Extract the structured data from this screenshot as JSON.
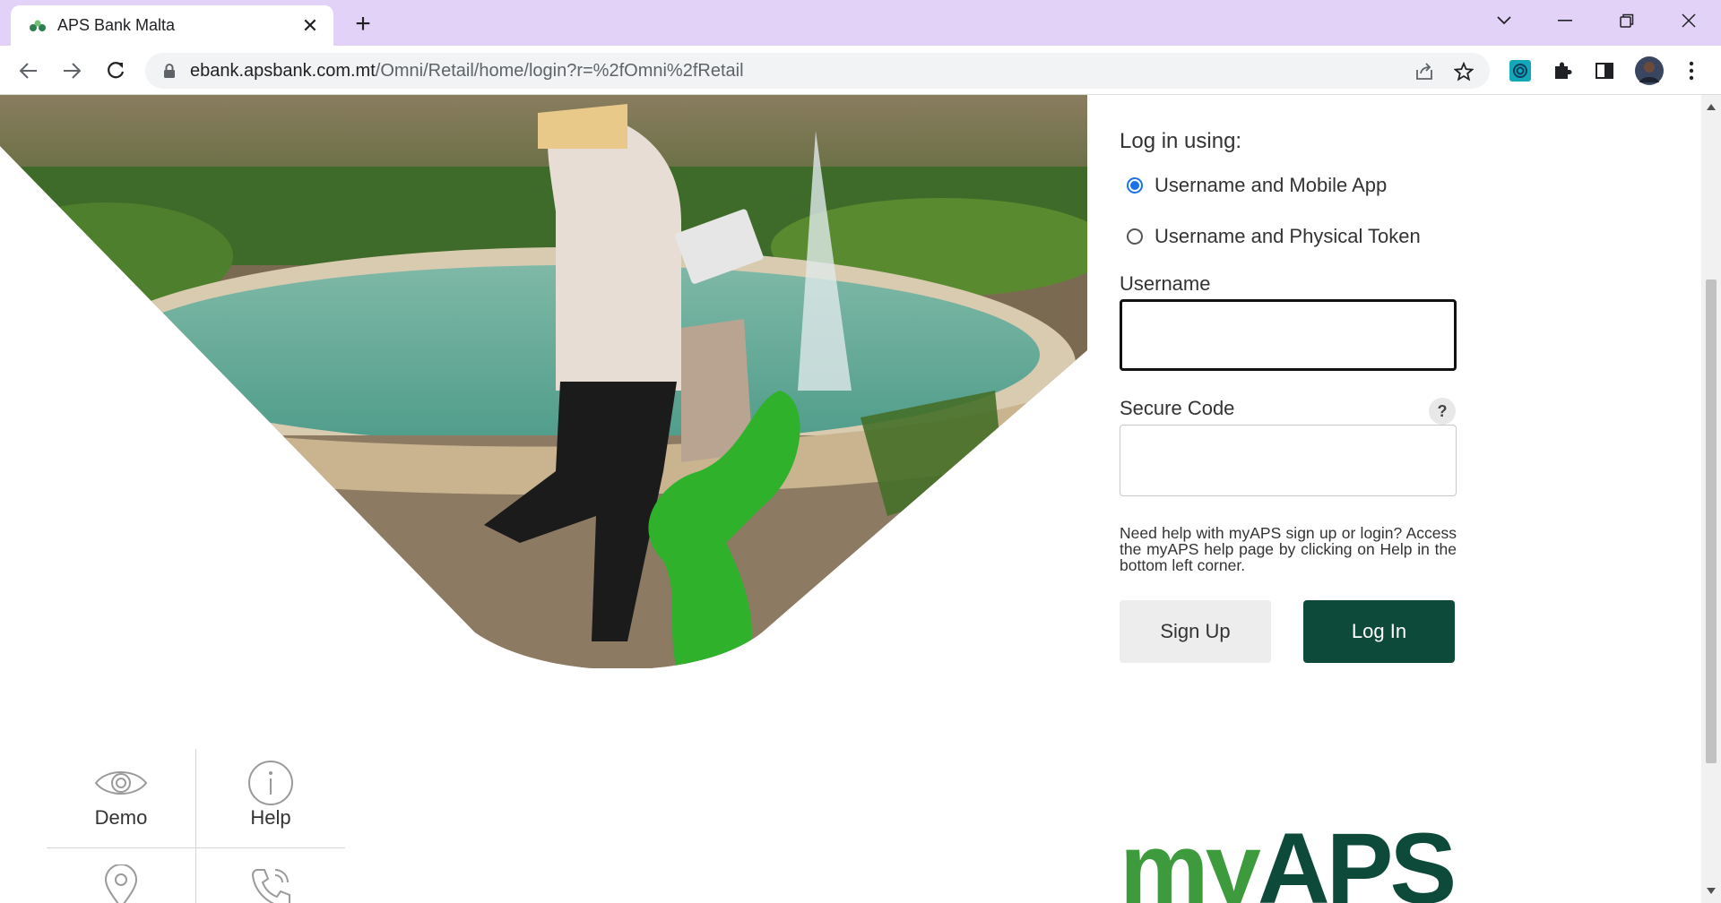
{
  "browser": {
    "tab_title": "APS Bank Malta",
    "url_host": "ebank.apsbank.com.mt",
    "url_path": "/Omni/Retail/home/login?r=%2fOmni%2fRetail",
    "icons": [
      "back-icon",
      "forward-icon",
      "reload-icon",
      "lock-icon",
      "share-icon",
      "bookmark-star-icon",
      "extension-icon",
      "puzzle-icon",
      "side-panel-icon",
      "profile-avatar",
      "menu-icon",
      "minimize-icon",
      "restore-icon",
      "close-icon",
      "tab-search-icon"
    ],
    "theme_color": "#e3d2f7"
  },
  "login": {
    "heading": "Log in using:",
    "options": [
      {
        "label": "Username and Mobile App",
        "selected": true
      },
      {
        "label": "Username and Physical Token",
        "selected": false
      }
    ],
    "username_label": "Username",
    "username_value": "",
    "secure_code_label": "Secure Code",
    "secure_code_value": "",
    "help_icon": "?",
    "help_text": "Need help with myAPS sign up or login? Access the myAPS help page by clicking on Help in the bottom left corner.",
    "signup_label": "Sign Up",
    "login_label": "Log In",
    "accent_color": "#0e4a3a"
  },
  "tiles": [
    {
      "label": "Demo",
      "icon": "eye-icon"
    },
    {
      "label": "Help",
      "icon": "info-icon"
    },
    {
      "label": "",
      "icon": "location-pin-icon"
    },
    {
      "label": "",
      "icon": "phone-icon"
    }
  ],
  "brand": {
    "my": "my",
    "aps": "APS"
  }
}
